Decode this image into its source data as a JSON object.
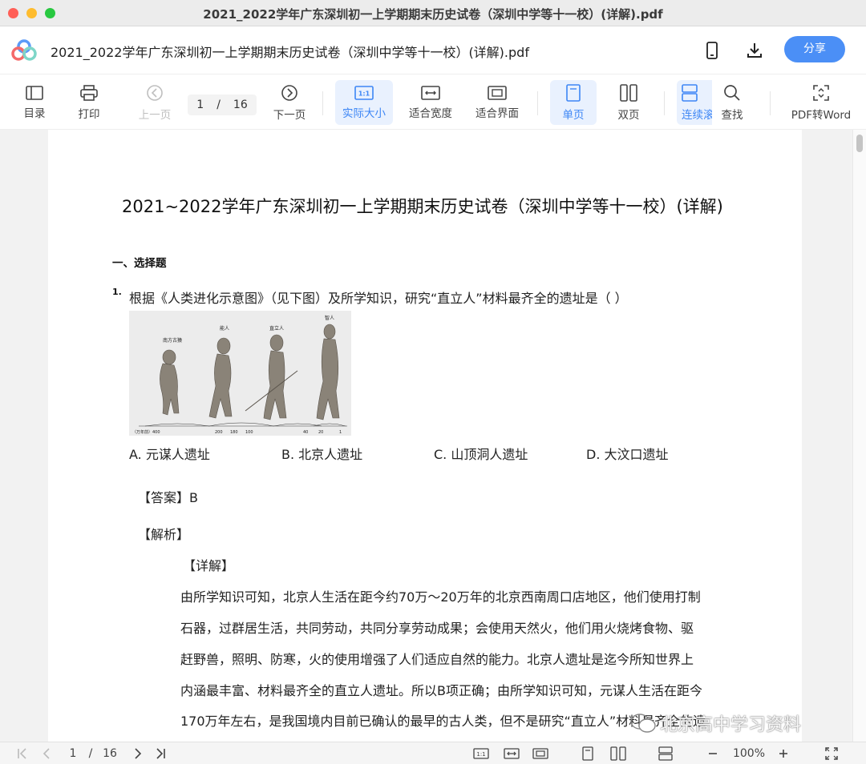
{
  "window": {
    "title": "2021_2022学年广东深圳初一上学期期末历史试卷（深圳中学等十一校）(详解).pdf"
  },
  "header": {
    "doc_title": "2021_2022学年广东深圳初一上学期期末历史试卷（深圳中学等十一校）(详解).pdf",
    "share_label": "分享",
    "accent": "#4b8ff6"
  },
  "toolbar": {
    "toc": "目录",
    "print": "打印",
    "prev": "上一页",
    "page_current": "1",
    "page_sep": "/",
    "page_total": "16",
    "next": "下一页",
    "actual_size": "实际大小",
    "fit_width": "适合宽度",
    "fit_page": "适合界面",
    "single": "单页",
    "double": "双页",
    "continuous": "连续滚",
    "find": "查找",
    "pdf_to_word": "PDF转Word"
  },
  "document": {
    "title": "2021~2022学年广东深圳初一上学期期末历史试卷（深圳中学等十一校）(详解)",
    "section": "一、选择题",
    "q_number": "1.",
    "question": "根据《人类进化示意图》（见下图）及所学知识，研究“直立人”材料最齐全的遗址是（     ）",
    "image_labels": [
      "南方古猿",
      "能人",
      "直立人",
      "智人"
    ],
    "image_axis": [
      "（万年前）400",
      "200",
      "180",
      "100",
      "40",
      "20",
      "1"
    ],
    "options": [
      "A. 元谋人遗址",
      "B. 北京人遗址",
      "C. 山顶洞人遗址",
      "D. 大汶口遗址"
    ],
    "answer_label": "【答案】",
    "answer_value": "B",
    "analysis_label": "【解析】",
    "detail_label": "【详解】",
    "body_lines": [
      "由所学知识可知，北京人生活在距今约70万～20万年的北京西南周口店地区，他们使用打制",
      "石器，过群居生活，共同劳动，共同分享劳动成果；会使用天然火，他们用火烧烤食物、驱",
      "赶野兽，照明、防寒，火的使用增强了人们适应自然的能力。北京人遗址是迄今所知世界上",
      "内涵最丰富、材料最齐全的直立人遗址。所以B项正确；由所学知识可知，元谋人生活在距今",
      "170万年左右，是我国境内目前已确认的最早的古人类，但不是研究“直立人”材料最齐全的遗"
    ],
    "watermark": "北京高中学习资料"
  },
  "statusbar": {
    "page_current": "1",
    "page_sep": "/",
    "page_total": "16",
    "zoom": "100%"
  }
}
